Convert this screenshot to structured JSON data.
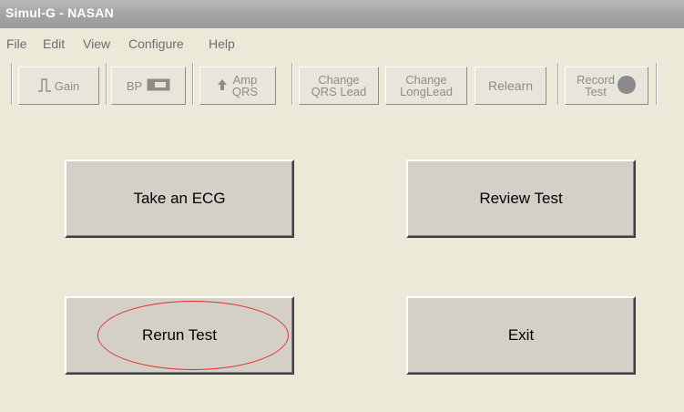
{
  "window": {
    "title": "Simul-G - NASAN"
  },
  "menu": [
    "File",
    "Edit",
    "View",
    "Configure",
    "Help"
  ],
  "toolbar": {
    "gain": "Gain",
    "bp": "BP",
    "amp_qrs": [
      "Amp",
      "QRS"
    ],
    "change_qrs_lead": [
      "Change",
      "QRS Lead"
    ],
    "change_long_lead": [
      "Change",
      "LongLead"
    ],
    "relearn": "Relearn",
    "record_test": [
      "Record",
      "Test"
    ]
  },
  "buttons": {
    "take_ecg": "Take an ECG",
    "review_test": "Review Test",
    "rerun_test": "Rerun Test",
    "exit": "Exit"
  },
  "colors": {
    "background": "#ece9d8",
    "titlebar": "#a8a8a8",
    "button_face": "#d4d0c8",
    "annotation": "#e03030"
  }
}
